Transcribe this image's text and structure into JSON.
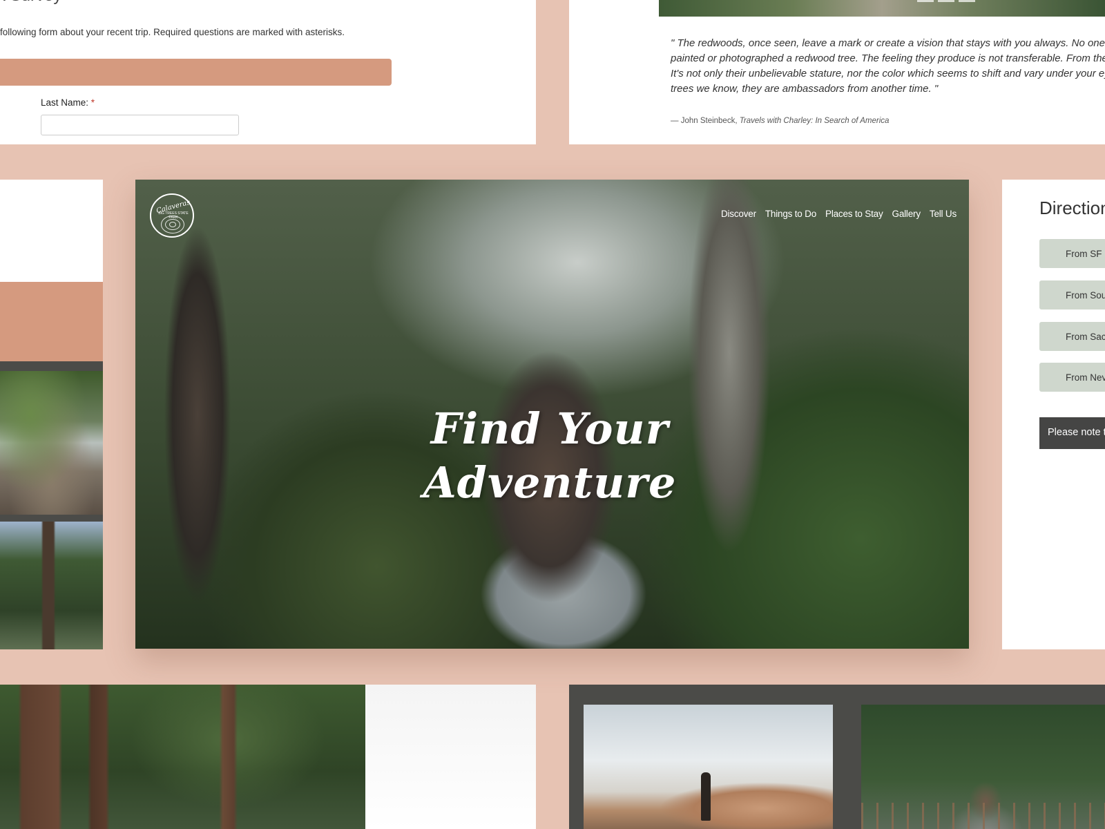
{
  "survey": {
    "title_fragment": "k Survey",
    "intro": "following form about your recent trip. Required questions are marked with asterisks.",
    "last_name_label": "Last Name:",
    "required_mark": "*",
    "last_name_value": ""
  },
  "quote": {
    "text": "\" The redwoods, once seen, leave a mark or create a vision that stays with you always. No one ha\npainted or photographed a redwood tree. The feeling they produce is not transferable. From ther\nIt's not only their unbelievable stature, nor the color which seems to shift and vary under your eye\ntrees we know, they are ambassadors from another time. \"",
    "author": "— John Steinbeck,",
    "source": "Travels with Charley: In Search of America"
  },
  "hero": {
    "logo_text": "Calaveras",
    "logo_subtext": "BIG TREES STATE PARK",
    "nav": [
      "Discover",
      "Things to Do",
      "Places to Stay",
      "Gallery",
      "Tell Us"
    ],
    "headline_line1": "Find Your",
    "headline_line2": "Adventure"
  },
  "directions": {
    "title": "Direction",
    "buttons": [
      "From SF B",
      "From Sout",
      "From Sacr",
      "From Neva"
    ],
    "note": "Please note th"
  },
  "colors": {
    "background": "#e7c3b3",
    "accent_peach": "#d59a7f",
    "direction_button": "#cfd7cd",
    "dark_panel": "#4b4b48"
  }
}
